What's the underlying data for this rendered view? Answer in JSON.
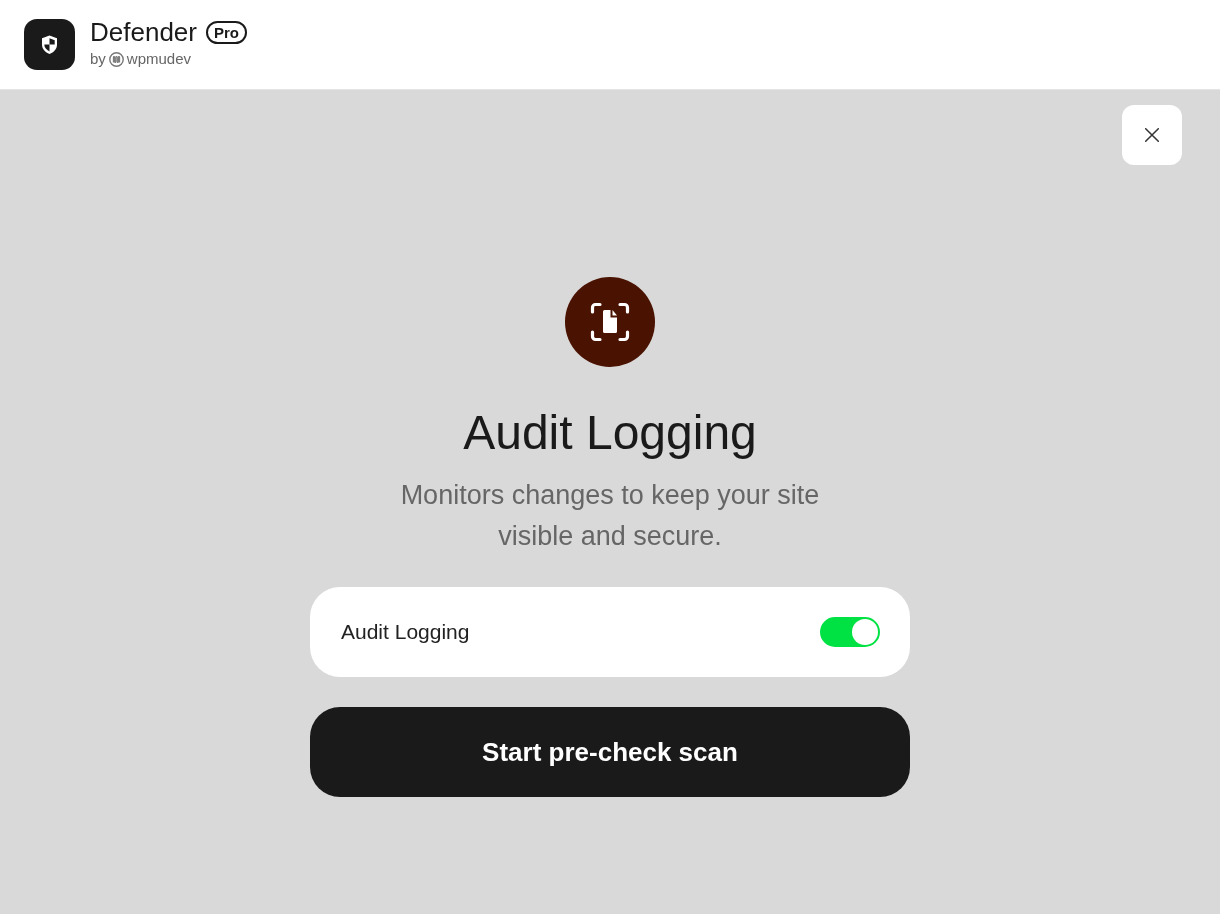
{
  "header": {
    "app_name": "Defender",
    "badge": "Pro",
    "byline_prefix": "by",
    "byline_brand": "wpmudev"
  },
  "feature": {
    "title": "Audit Logging",
    "description": "Monitors changes to keep your site visible and secure."
  },
  "settings": [
    {
      "kind": "toggle",
      "label": "Audit Logging",
      "on": true
    }
  ],
  "primary_button": {
    "label": "Start pre-check scan"
  }
}
